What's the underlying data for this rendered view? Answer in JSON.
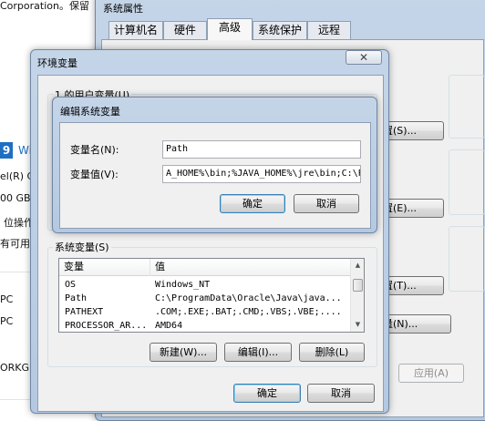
{
  "background": {
    "lines": [
      "Corporation。保留",
      "Wi",
      "el(R) C",
      "00 GB",
      "位操作",
      "有可用",
      "PC",
      "PC",
      "ORKG"
    ]
  },
  "system_properties": {
    "title": "系统属性",
    "tabs": [
      "计算机名",
      "硬件",
      "高级",
      "系统保护",
      "远程"
    ],
    "active_tab": 2,
    "buttons": {
      "settings1": "置(S)...",
      "settings2": "置(E)...",
      "settings3": "置(T)...",
      "env_vars": "量(N)...",
      "apply": "应用(A)"
    }
  },
  "env_vars": {
    "title": "环境变量",
    "close_glyph": "✕",
    "user_group_label": "1 的用户变量(U)",
    "system_group_label": "系统变量(S)",
    "system_list": {
      "columns": [
        "变量",
        "值"
      ],
      "rows": [
        {
          "name": "OS",
          "value": "Windows_NT"
        },
        {
          "name": "Path",
          "value": "C:\\ProgramData\\Oracle\\Java\\java..."
        },
        {
          "name": "PATHEXT",
          "value": ".COM;.EXE;.BAT;.CMD;.VBS;.VBE;...."
        },
        {
          "name": "PROCESSOR_AR...",
          "value": "AMD64"
        }
      ]
    },
    "buttons": {
      "new": "新建(W)...",
      "edit": "编辑(I)...",
      "delete": "删除(L)",
      "ok": "确定",
      "cancel": "取消"
    }
  },
  "edit_dialog": {
    "title": "编辑系统变量",
    "name_label": "变量名(N):",
    "name_value": "Path",
    "value_label": "变量值(V):",
    "value_value": "A_HOME%\\bin;%JAVA_HOME%\\jre\\bin;C:\\P",
    "ok": "确定",
    "cancel": "取消"
  }
}
